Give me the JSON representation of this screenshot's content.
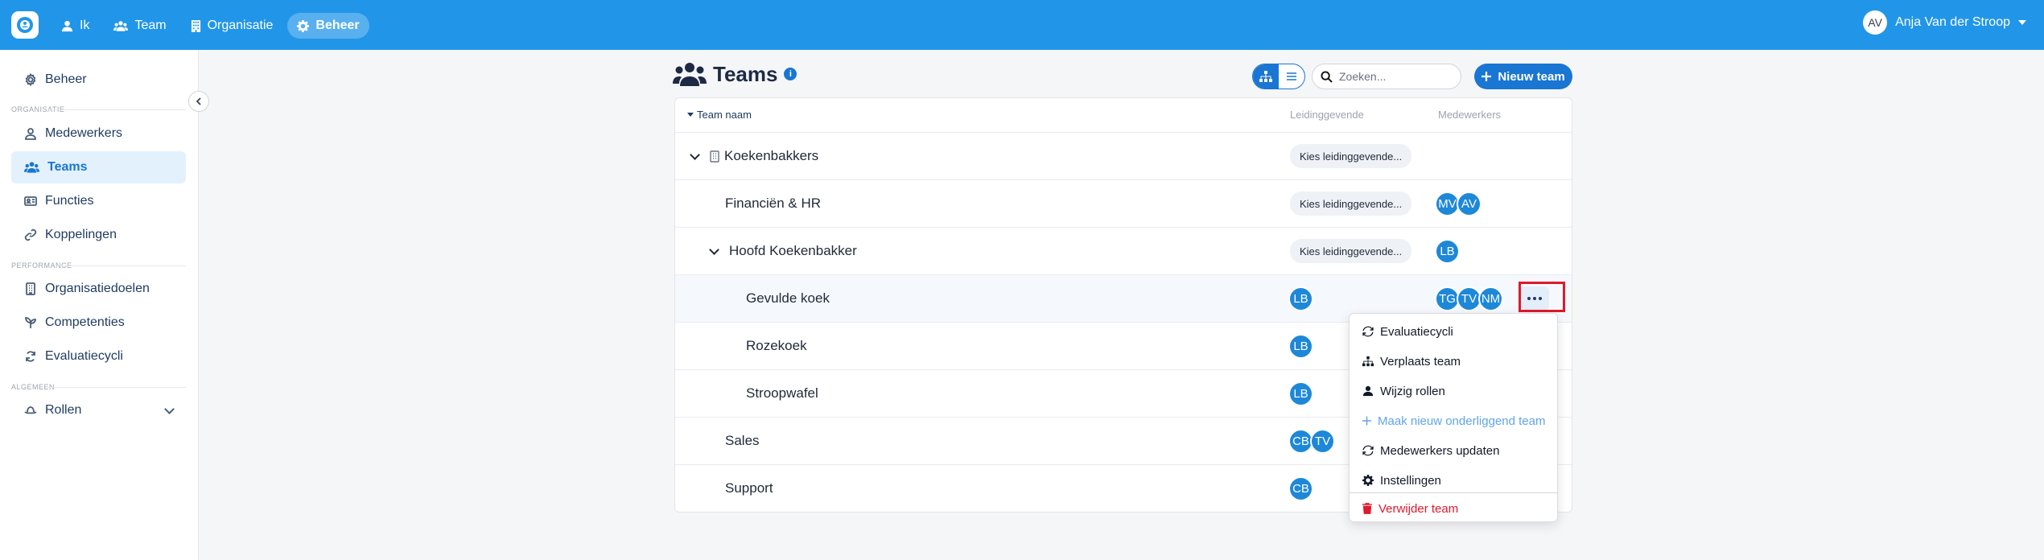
{
  "topbar": {
    "nav": [
      {
        "label": "Ik",
        "icon": "user-icon"
      },
      {
        "label": "Team",
        "icon": "users-icon"
      },
      {
        "label": "Organisatie",
        "icon": "building-icon"
      },
      {
        "label": "Beheer",
        "icon": "gear-icon",
        "active": true
      }
    ],
    "user_initials": "AV",
    "user_name": "Anja Van der Stroop"
  },
  "sidebar": {
    "top_item": "Beheer",
    "sections": [
      "ORGANISATIE",
      "PERFORMANCE",
      "ALGEMEEN"
    ],
    "items": [
      {
        "label": "Medewerkers",
        "icon": "person-icon"
      },
      {
        "label": "Teams",
        "icon": "users-icon",
        "active": true
      },
      {
        "label": "Functies",
        "icon": "id-card-icon"
      },
      {
        "label": "Koppelingen",
        "icon": "link-icon"
      },
      {
        "label": "Organisatiedoelen",
        "icon": "building-icon"
      },
      {
        "label": "Competenties",
        "icon": "sprout-icon"
      },
      {
        "label": "Evaluatiecycli",
        "icon": "refresh-icon"
      },
      {
        "label": "Rollen",
        "icon": "hat-icon"
      }
    ]
  },
  "page": {
    "title": "Teams",
    "info": "i",
    "search_placeholder": "Zoeken...",
    "new_team_label": "Nieuw team"
  },
  "table": {
    "headers": {
      "name": "Team naam",
      "lead": "Leidinggevende",
      "members": "Medewerkers"
    },
    "lead_placeholder": "Kies leidinggevende...",
    "rows": [
      {
        "name": "Koekenbakkers",
        "members": []
      },
      {
        "name": "Financiën & HR",
        "members": [
          "MV",
          "AV"
        ]
      },
      {
        "name": "Hoofd Koekenbakker",
        "members": [
          "LB"
        ]
      },
      {
        "name": "Gevulde koek",
        "lead": "LB",
        "members": [
          "TG",
          "TV",
          "NM"
        ]
      },
      {
        "name": "Rozekoek",
        "lead": "LB",
        "members": []
      },
      {
        "name": "Stroopwafel",
        "lead": "LB",
        "members": []
      },
      {
        "name": "Sales",
        "lead": [
          "CB",
          "TV"
        ],
        "members": []
      },
      {
        "name": "Support",
        "lead": "CB",
        "members": []
      }
    ]
  },
  "menu": {
    "items": [
      {
        "label": "Evaluatiecycli",
        "icon": "refresh-icon"
      },
      {
        "label": "Verplaats team",
        "icon": "sitemap-icon"
      },
      {
        "label": "Wijzig rollen",
        "icon": "user-icon"
      },
      {
        "label": "Maak nieuw onderliggend team",
        "icon": "plus-icon"
      },
      {
        "label": "Medewerkers updaten",
        "icon": "refresh-icon"
      },
      {
        "label": "Instellingen",
        "icon": "gear-icon"
      },
      {
        "label": "Verwijder team",
        "icon": "trash-icon"
      }
    ]
  },
  "colors": {
    "primary": "#2196e8",
    "accent": "#1976d2",
    "danger": "#e0192b",
    "highlight": "#e0192b"
  }
}
